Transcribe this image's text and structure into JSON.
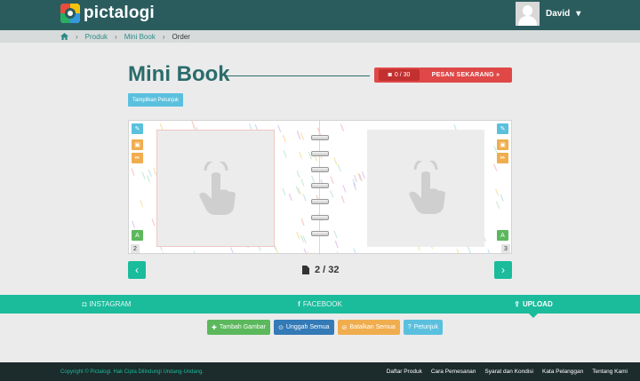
{
  "brand": {
    "name": "pictalogi"
  },
  "user": {
    "name": "David"
  },
  "breadcrumb": {
    "items": [
      "Produk",
      "Mini Book",
      "Order"
    ]
  },
  "page": {
    "title": "Mini Book"
  },
  "order": {
    "count": "0 / 30",
    "label": "PESAN SEKARANG"
  },
  "guide": {
    "label": "Tampilkan Petunjuk"
  },
  "book": {
    "left_page": "2",
    "right_page": "3"
  },
  "pager": {
    "text": "2 / 32"
  },
  "tabs": [
    {
      "label": "INSTAGRAM",
      "icon": "instagram-icon"
    },
    {
      "label": "FACEBOOK",
      "icon": "facebook-icon"
    },
    {
      "label": "UPLOAD",
      "icon": "upload-icon",
      "active": true
    }
  ],
  "actions": {
    "add": "Tambah Gambar",
    "upload_all": "Unggah Semua",
    "cancel_all": "Batalkan Semua",
    "help": "Petunjuk"
  },
  "footer": {
    "copyright": "Copyright © Pictalogi. Hak Cipta Dilindungi Undang-Undang.",
    "links": [
      "Daftar Produk",
      "Cara Pemesanan",
      "Syarat dan Kondisi",
      "Kata Pelanggan",
      "Tentang Kami"
    ]
  },
  "colors": {
    "header": "#2a5c5e",
    "accent": "#1abc9c",
    "order": "#e04848",
    "title": "#2a6b6b"
  }
}
